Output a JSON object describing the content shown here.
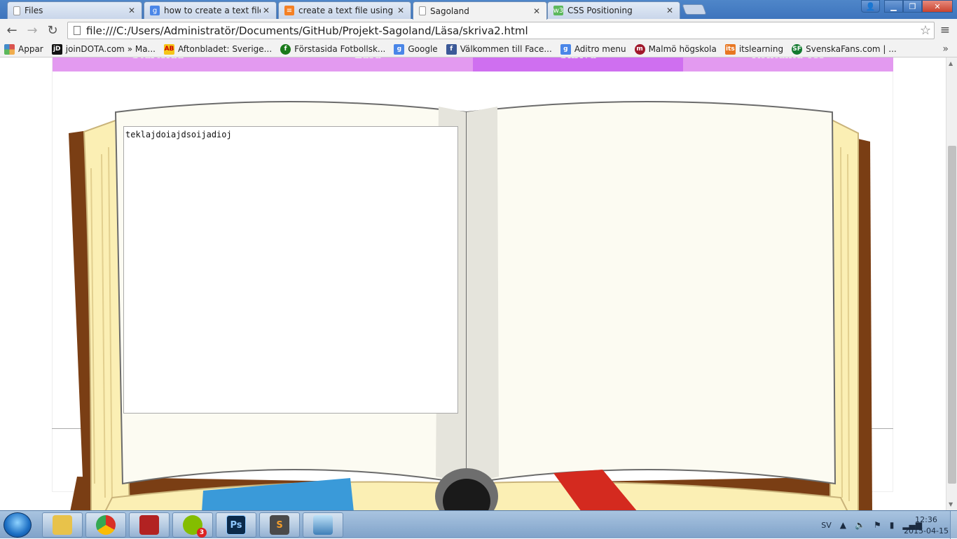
{
  "browser": {
    "tabs": [
      {
        "title": "Files",
        "favicon": "page-icon",
        "active": false
      },
      {
        "title": "how to create a text file in",
        "favicon": "google-icon",
        "active": false
      },
      {
        "title": "create a text file using java",
        "favicon": "stackoverflow-icon",
        "active": false
      },
      {
        "title": "Sagoland",
        "favicon": "page-icon",
        "active": true
      },
      {
        "title": "CSS Positioning",
        "favicon": "w3schools-icon",
        "active": false
      }
    ],
    "address": "file:///C:/Users/Administratör/Documents/GitHub/Projekt-Sagoland/Läsa/skriva2.html",
    "bookmarks": [
      {
        "label": "Appar",
        "icon": "apps-icon",
        "color": "#d9534f"
      },
      {
        "label": "joinDOTA.com » Ma...",
        "icon": "joindota-icon",
        "color": "#111111"
      },
      {
        "label": "Aftonbladet: Sverige...",
        "icon": "aftonbladet-icon",
        "color": "#f5c518"
      },
      {
        "label": "Förstasida Fotbollsk...",
        "icon": "fotboll-icon",
        "color": "#1a7a1a"
      },
      {
        "label": "Google",
        "icon": "google-icon",
        "color": "#4a86e8"
      },
      {
        "label": "Välkommen till Face...",
        "icon": "facebook-icon",
        "color": "#3b5998"
      },
      {
        "label": "Aditro menu",
        "icon": "google-icon",
        "color": "#4a86e8"
      },
      {
        "label": "Malmö högskola",
        "icon": "mah-icon",
        "color": "#a0182b"
      },
      {
        "label": "itslearning",
        "icon": "itslearning-icon",
        "color": "#e87722"
      },
      {
        "label": "SvenskaFans.com | ...",
        "icon": "svenskafans-icon",
        "color": "#137a2f"
      }
    ]
  },
  "page": {
    "nav": [
      "Startsida",
      "Läsa",
      "Skriva",
      "Kontakta oss"
    ],
    "active_nav": 2,
    "editor_text": "teklajdoiajdsoijadioj"
  },
  "taskbar": {
    "apps": [
      {
        "name": "explorer",
        "icon": "folder-icon",
        "color": "#e8c24a"
      },
      {
        "name": "chrome",
        "icon": "chrome-icon",
        "color": "#4caf50"
      },
      {
        "name": "dota",
        "icon": "dota-icon",
        "color": "#b22222"
      },
      {
        "name": "spotify",
        "icon": "spotify-icon",
        "color": "#84bd00",
        "badge": "3"
      },
      {
        "name": "photoshop",
        "icon": "photoshop-icon",
        "color": "#0b2a4a",
        "glyph": "Ps"
      },
      {
        "name": "sublime",
        "icon": "sublime-icon",
        "color": "#4a4a4a"
      },
      {
        "name": "photo-viewer",
        "icon": "picture-icon",
        "color": "#3f7fb8"
      }
    ],
    "language": "SV",
    "time": "12:36",
    "date": "2015-04-15"
  }
}
